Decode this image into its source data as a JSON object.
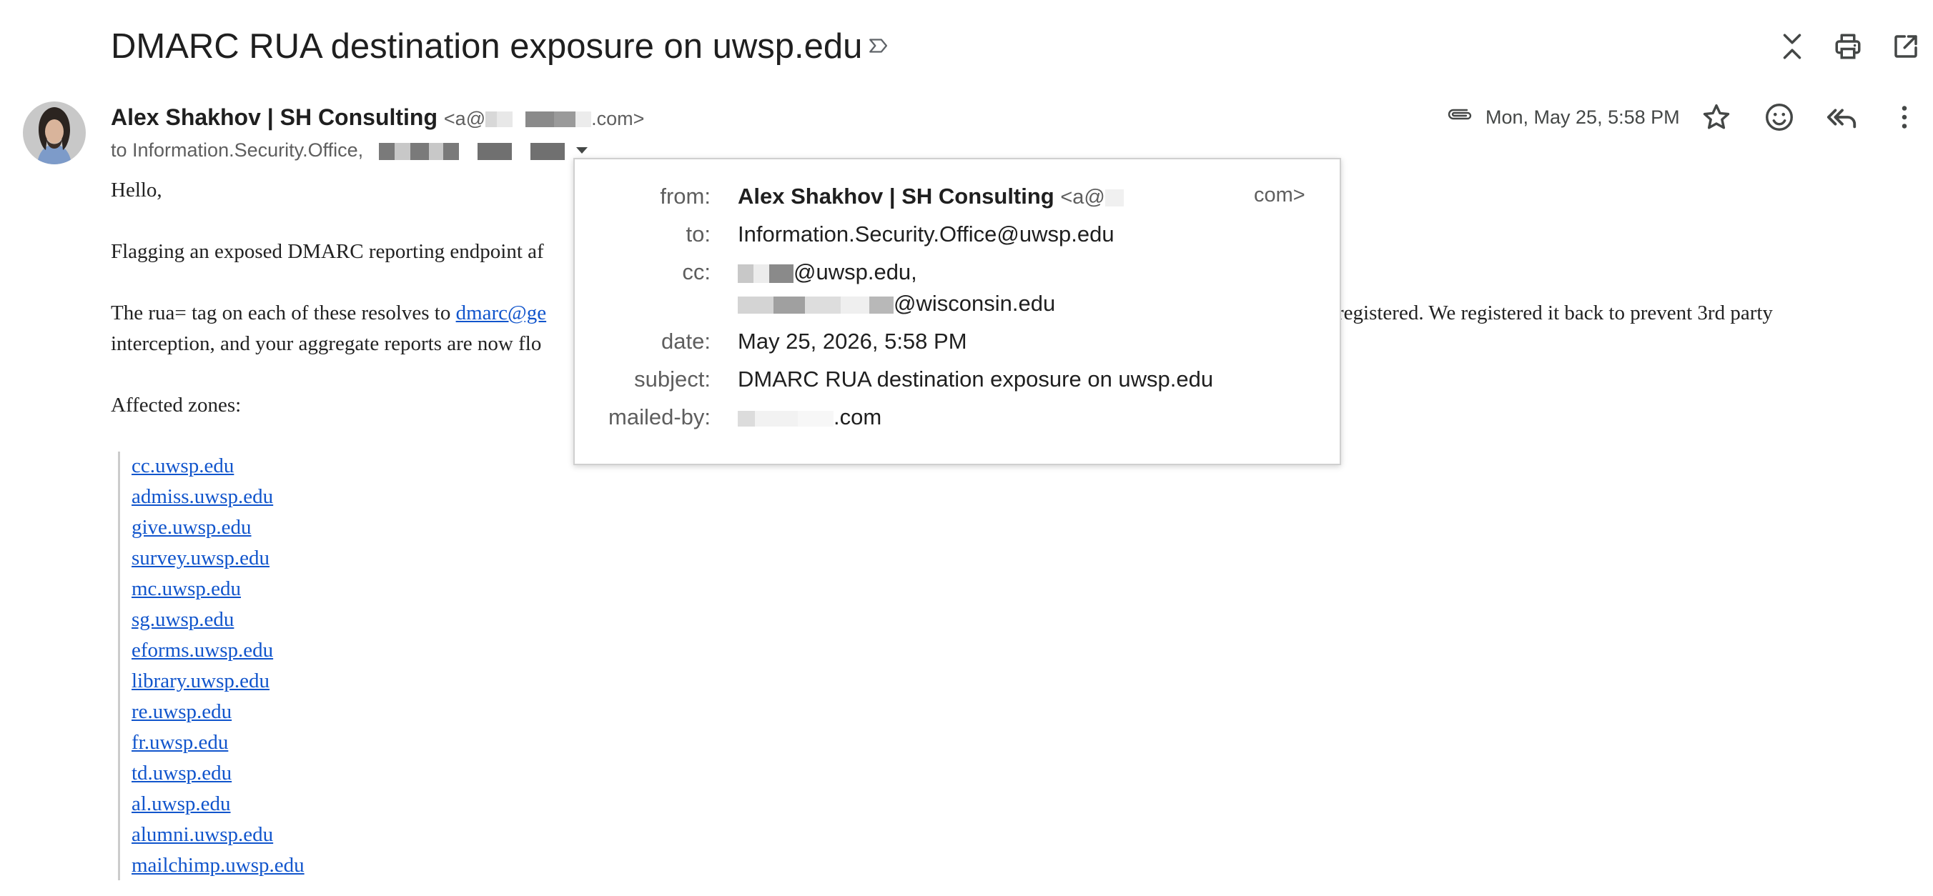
{
  "header": {
    "subject": "DMARC RUA destination exposure on uwsp.edu"
  },
  "icons": {
    "label": "label-outline-icon",
    "collapse": "collapse-all-icon",
    "print": "print-icon",
    "open_new": "open-in-new-window-icon",
    "attachment": "attachment-icon",
    "star": "star-icon",
    "emoji": "emoji-reaction-icon",
    "reply_all": "reply-all-icon",
    "more": "more-options-icon",
    "caret": "caret-down-icon"
  },
  "message": {
    "sender_name": "Alex Shakhov | SH Consulting",
    "sender_email_start": "<a@",
    "sender_email_end": ".com>",
    "to_label": "to Information.Security.Office,",
    "date": "Mon, May 25, 5:58 PM"
  },
  "popup": {
    "from_label": "from:",
    "from_name": "Alex Shakhov | SH Consulting",
    "from_email_start": "<a@",
    "from_email_end": "com>",
    "to_label": "to:",
    "to_value": "Information.Security.Office@uwsp.edu",
    "cc_label": "cc:",
    "cc_value_1": "@uwsp.edu,",
    "cc_value_2": "@wisconsin.edu",
    "date_label": "date:",
    "date_value": "May 25, 2026, 5:58 PM",
    "subject_label": "subject:",
    "subject_value": "DMARC RUA destination exposure on uwsp.edu",
    "mailed_by_label": "mailed-by:",
    "mailed_by_value": ".com"
  },
  "body": {
    "greeting": "Hello,",
    "line1": "Flagging an exposed DMARC reporting endpoint af",
    "line2_start": "The rua= tag on each of these resolves to ",
    "line2_link": "dmarc@ge",
    "line2_end": "registered. We registered it back to prevent 3rd party",
    "line3": "interception, and your aggregate reports are now flo",
    "affected_label": "Affected zones:",
    "zones": [
      "cc.uwsp.edu",
      "admiss.uwsp.edu",
      "give.uwsp.edu",
      "survey.uwsp.edu",
      "mc.uwsp.edu",
      "sg.uwsp.edu",
      "eforms.uwsp.edu",
      "library.uwsp.edu",
      "re.uwsp.edu",
      "fr.uwsp.edu",
      "td.uwsp.edu",
      "al.uwsp.edu",
      "alumni.uwsp.edu",
      "mailchimp.uwsp.edu"
    ]
  }
}
